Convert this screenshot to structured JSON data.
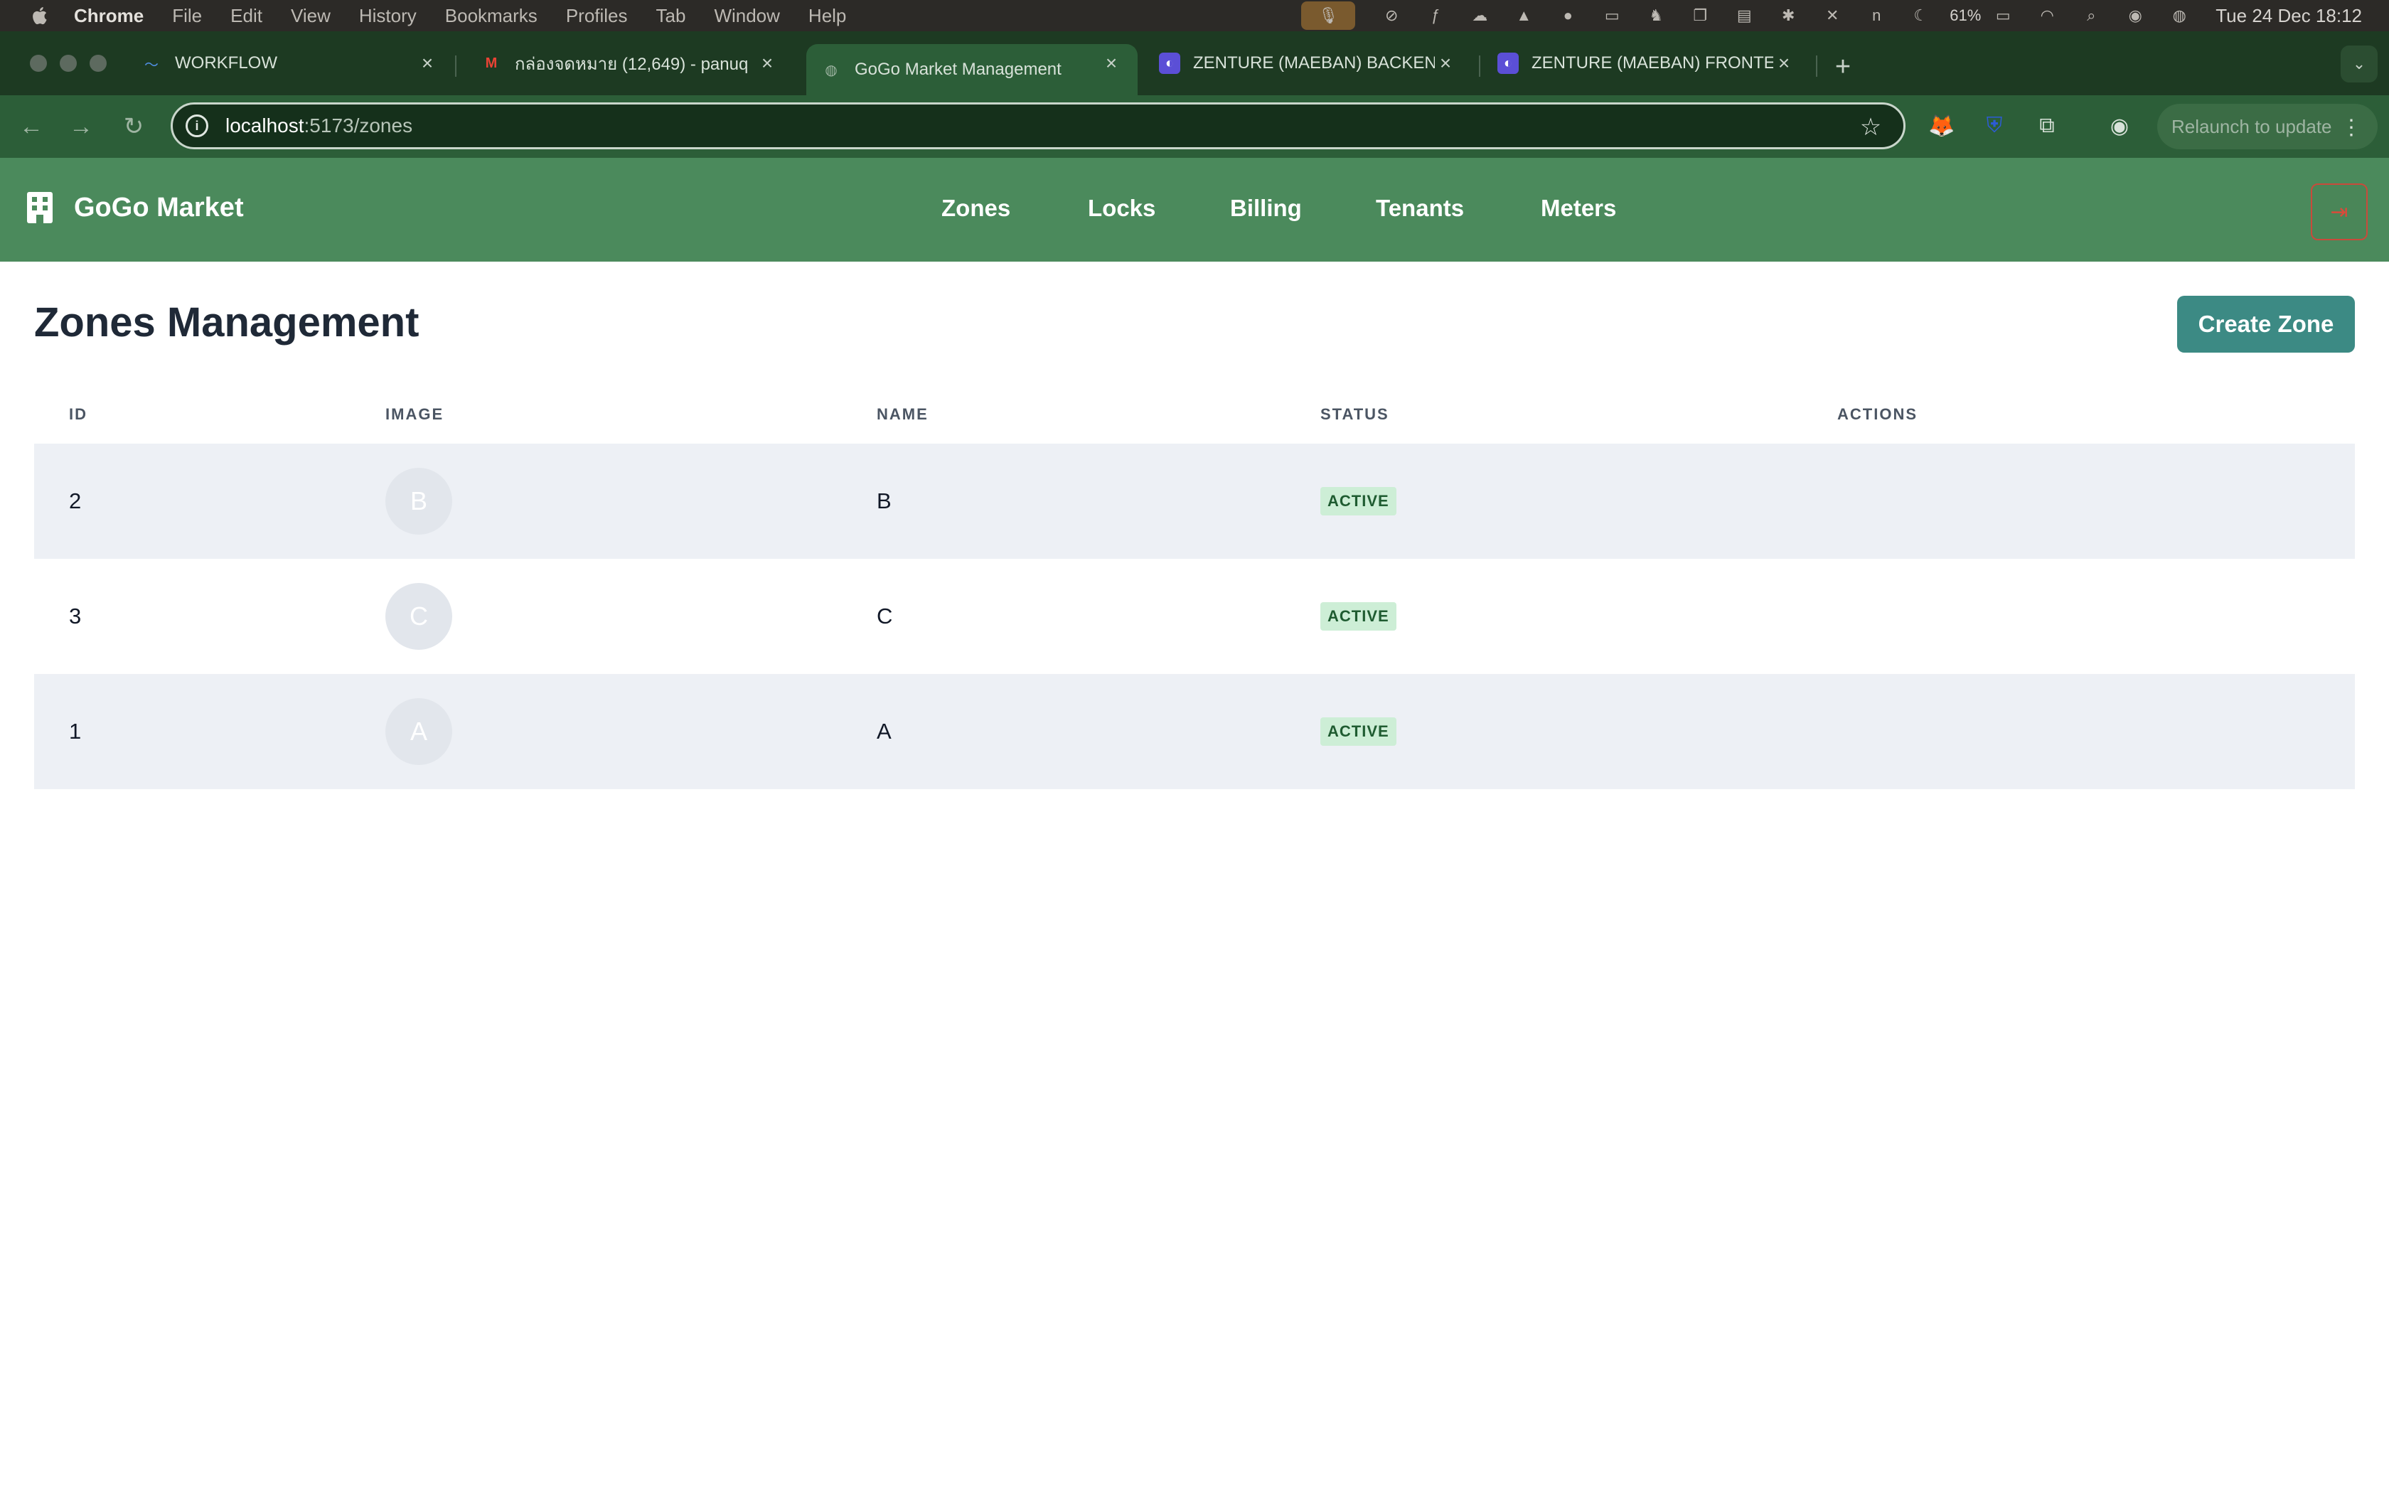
{
  "menubar": {
    "app": "Chrome",
    "items": [
      "File",
      "Edit",
      "View",
      "History",
      "Bookmarks",
      "Profiles",
      "Tab",
      "Window",
      "Help"
    ],
    "battery": "61%",
    "clock": "Tue 24 Dec  18:12"
  },
  "tabs": [
    {
      "title": "WORKFLOW",
      "active": false
    },
    {
      "title": "กล่องจดหมาย (12,649) - panuq",
      "active": false
    },
    {
      "title": "GoGo Market Management",
      "active": true
    },
    {
      "title": "ZENTURE (MAEBAN) BACKEN",
      "active": false
    },
    {
      "title": "ZENTURE (MAEBAN) FRONTE",
      "active": false
    }
  ],
  "address": {
    "host": "localhost",
    "path": ":5173/zones"
  },
  "relaunch": "Relaunch to update",
  "app": {
    "brand": "GoGo Market",
    "nav": [
      "Zones",
      "Locks",
      "Billing",
      "Tenants",
      "Meters"
    ]
  },
  "page": {
    "title": "Zones Management",
    "create_button": "Create Zone",
    "columns": [
      "ID",
      "IMAGE",
      "NAME",
      "STATUS",
      "ACTIONS"
    ],
    "rows": [
      {
        "id": "2",
        "image": "B",
        "name": "B",
        "status": "ACTIVE"
      },
      {
        "id": "3",
        "image": "C",
        "name": "C",
        "status": "ACTIVE"
      },
      {
        "id": "1",
        "image": "A",
        "name": "A",
        "status": "ACTIVE"
      }
    ]
  },
  "colors": {
    "header_green": "#4b8a5c",
    "create_button": "#3c8a84",
    "badge_bg": "#cdeed6",
    "badge_text": "#1f5c31"
  }
}
